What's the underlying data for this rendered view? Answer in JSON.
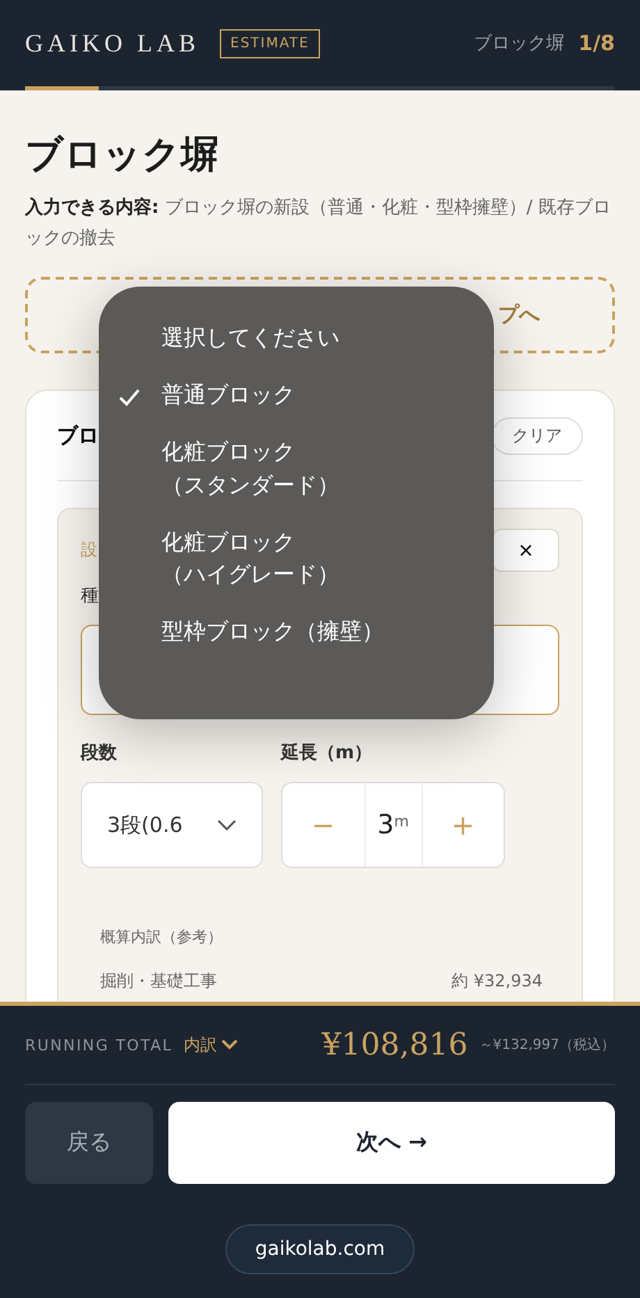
{
  "header": {
    "logo": "GAIKO LAB",
    "badge": "ESTIMATE",
    "step_label": "ブロック塀",
    "step_count": "1/8",
    "progress": {
      "level": 0.125
    }
  },
  "page": {
    "title": "ブロック塀",
    "description": "**入力できる内容:** ブロック塀の新設（普通・化粧・型枠擁壁）/ 既存ブロックの撤去"
  },
  "dashed_link": {
    "label": "プへ"
  },
  "card": {
    "title": "ブロ",
    "clear_button": "クリア",
    "item": {
      "label": "設",
      "remove_button": "×",
      "type_label": "種",
      "tiers_label": "段数",
      "tiers_value": "3段(0.6",
      "length_label": "延長（m）",
      "stepper": {
        "minus": "−",
        "value": "3",
        "unit": "m",
        "plus": "+"
      },
      "breakdown_title": "概算内訳（参考）",
      "breakdown_rows": [
        {
          "label": "掘削・基礎工事",
          "value": "約 ¥32,934"
        }
      ]
    }
  },
  "dropdown": {
    "options": [
      {
        "label": "選択してください",
        "selected": false
      },
      {
        "label": "普通ブロック",
        "selected": true
      },
      {
        "label": "化粧ブロック（スタンダード）",
        "selected": false
      },
      {
        "label": "化粧ブロック（ハイグレード）",
        "selected": false
      },
      {
        "label": "型枠ブロック（擁壁）",
        "selected": false
      }
    ]
  },
  "footer": {
    "running_total_label": "RUNNING TOTAL",
    "breakdown_toggle": "内訳",
    "total": "¥108,816",
    "range": "～¥132,997（税込）",
    "back_button": "戻る",
    "next_button": "次へ →",
    "site_link": "gaikolab.com"
  }
}
